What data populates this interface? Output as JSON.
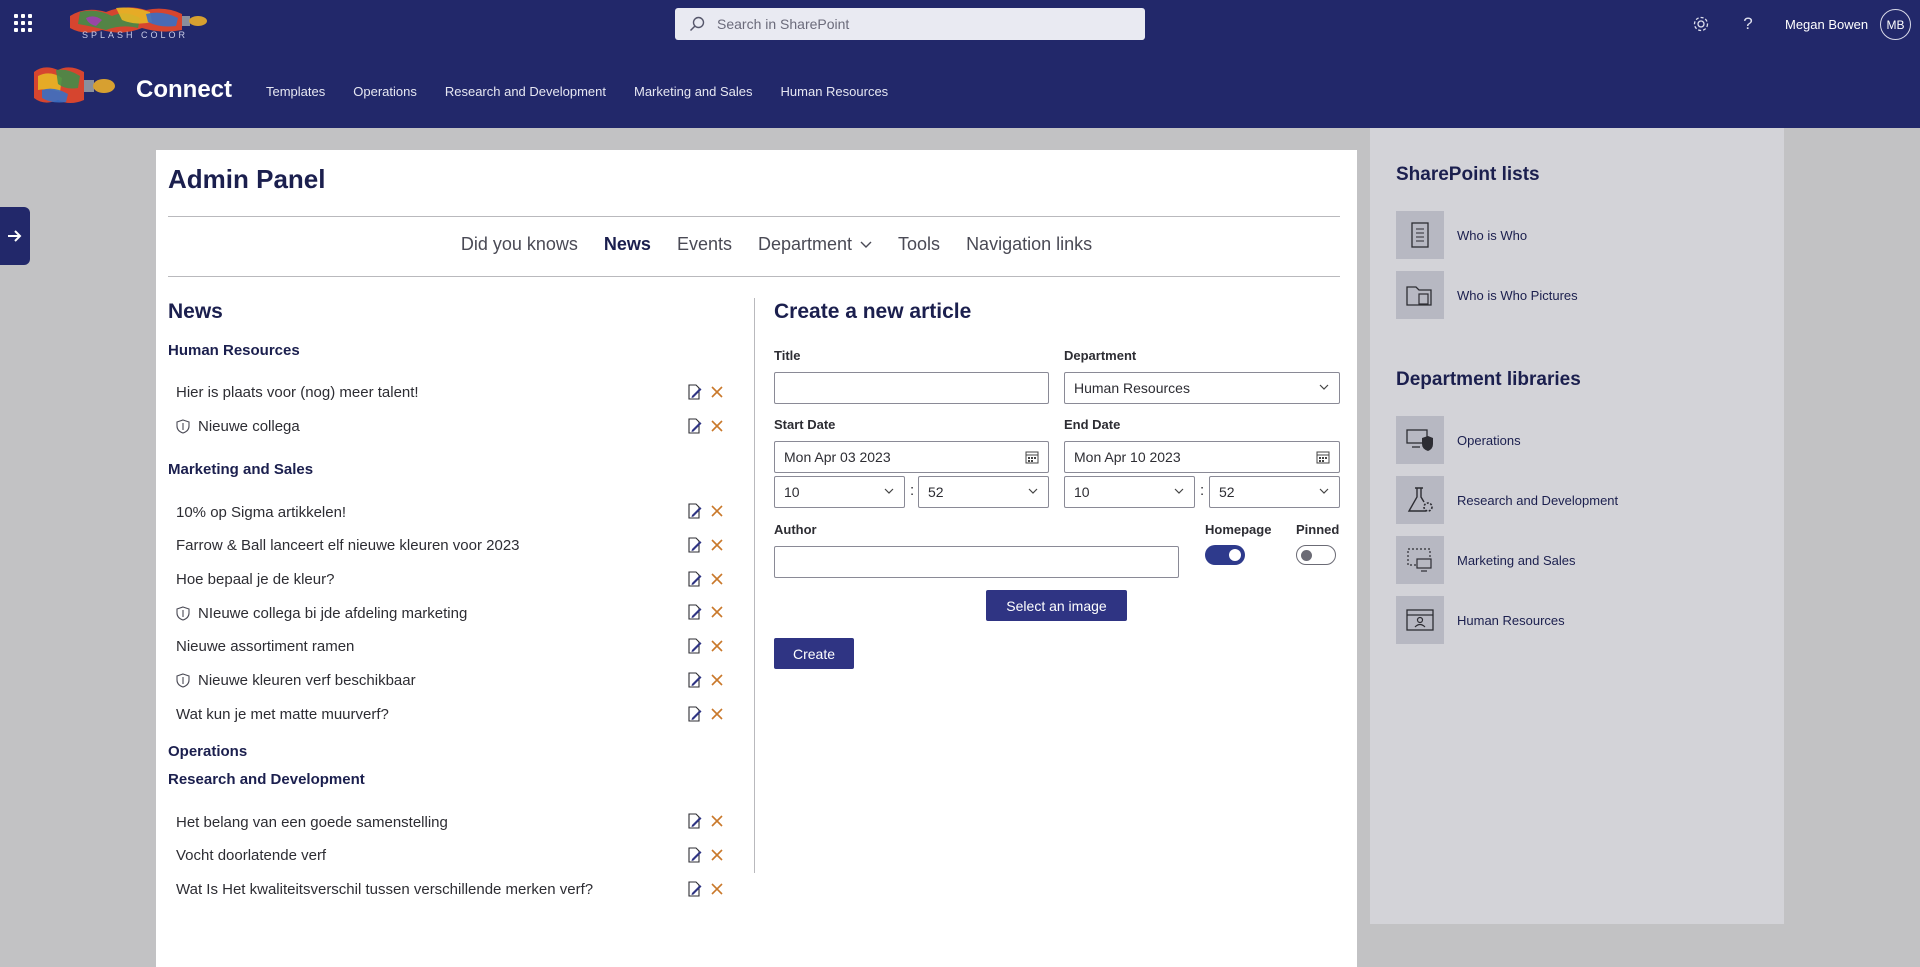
{
  "suite_bar": {
    "brand_text": "SPLASH  COLOR",
    "search_placeholder": "Search in SharePoint",
    "user_name": "Megan Bowen",
    "user_initials": "MB",
    "icons": [
      "waffle-icon",
      "search-icon",
      "settings-icon",
      "help-icon"
    ]
  },
  "site_header": {
    "title": "Connect",
    "nav": [
      "Templates",
      "Operations",
      "Research and Development",
      "Marketing and Sales",
      "Human Resources"
    ]
  },
  "admin": {
    "title": "Admin Panel",
    "tabs": [
      {
        "label": "Did you knows",
        "active": false
      },
      {
        "label": "News",
        "active": true
      },
      {
        "label": "Events",
        "active": false
      },
      {
        "label": "Department",
        "active": false,
        "dropdown": true
      },
      {
        "label": "Tools",
        "active": false
      },
      {
        "label": "Navigation links",
        "active": false
      }
    ]
  },
  "news": {
    "heading": "News",
    "groups": [
      {
        "name": "Human Resources",
        "items": [
          {
            "title": "Hier is plaats voor (nog) meer talent!",
            "shield": false
          },
          {
            "title": "Nieuwe collega",
            "shield": true
          }
        ]
      },
      {
        "name": "Marketing and Sales",
        "items": [
          {
            "title": "10% op Sigma artikkelen!",
            "shield": false
          },
          {
            "title": "Farrow & Ball lanceert elf nieuwe kleuren voor 2023",
            "shield": false
          },
          {
            "title": "Hoe bepaal je de kleur?",
            "shield": false
          },
          {
            "title": "NIeuwe collega bi jde afdeling marketing",
            "shield": true
          },
          {
            "title": "Nieuwe assortiment ramen",
            "shield": false
          },
          {
            "title": "Nieuwe kleuren verf beschikbaar",
            "shield": true
          },
          {
            "title": "Wat kun je met matte muurverf?",
            "shield": false
          }
        ]
      },
      {
        "name": "Operations",
        "items": []
      },
      {
        "name": "Research and Development",
        "items": [
          {
            "title": "Het belang van een goede samenstelling",
            "shield": false
          },
          {
            "title": "Vocht doorlatende verf",
            "shield": false
          },
          {
            "title": "Wat Is Het kwaliteitsverschil tussen verschillende merken verf?",
            "shield": false
          }
        ]
      }
    ]
  },
  "form": {
    "heading": "Create a new article",
    "title_label": "Title",
    "title_value": "",
    "department_label": "Department",
    "department_value": "Human Resources",
    "start_label": "Start Date",
    "start_date": "Mon Apr 03 2023",
    "start_hour": "10",
    "start_minute": "52",
    "end_label": "End Date",
    "end_date": "Mon Apr 10 2023",
    "end_hour": "10",
    "end_minute": "52",
    "colon": ":",
    "author_label": "Author",
    "author_value": "",
    "homepage_label": "Homepage",
    "homepage_on": true,
    "pinned_label": "Pinned",
    "pinned_on": false,
    "select_image_label": "Select an image",
    "create_label": "Create"
  },
  "side": {
    "lists_heading": "SharePoint lists",
    "lists": [
      {
        "label": "Who is Who",
        "icon": "document-list-icon"
      },
      {
        "label": "Who is Who Pictures",
        "icon": "folder-documents-icon"
      }
    ],
    "libraries_heading": "Department libraries",
    "libraries": [
      {
        "label": "Operations",
        "icon": "computer-shield-icon"
      },
      {
        "label": "Research and Development",
        "icon": "flask-gear-icon"
      },
      {
        "label": "Marketing and Sales",
        "icon": "screen-dashed-icon"
      },
      {
        "label": "Human Resources",
        "icon": "contact-card-icon"
      }
    ]
  },
  "colors": {
    "header_bg": "#22286a",
    "accent": "#2f3483",
    "delete_x": "#c9782a",
    "page_bg": "#c2c2c4",
    "side_bg": "#d3d3d8"
  }
}
